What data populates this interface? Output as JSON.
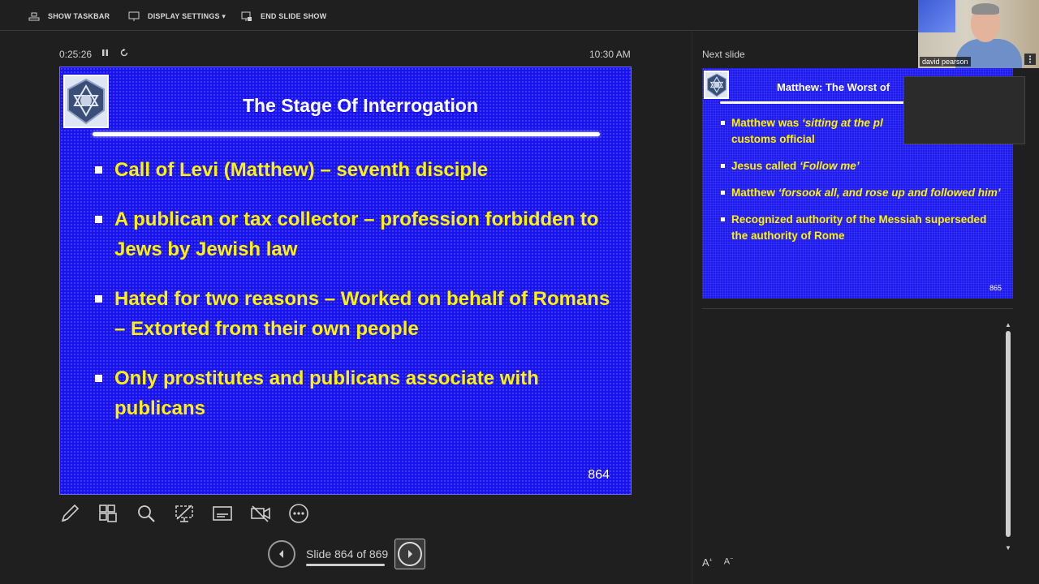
{
  "toolbar": {
    "show_taskbar": "SHOW TASKBAR",
    "display_settings": "DISPLAY SETTINGS ▾",
    "end_slide_show": "END SLIDE SHOW"
  },
  "presenter": {
    "elapsed": "0:25:26",
    "clock": "10:30 AM"
  },
  "current_slide": {
    "title": "The Stage Of Interrogation",
    "bullets": [
      "Call of Levi (Matthew) – seventh disciple",
      "A publican or tax collector – profession forbidden to Jews by Jewish law",
      "Hated for two reasons – Worked on behalf of Romans – Extorted from their own people",
      "Only prostitutes and publicans associate with publicans"
    ],
    "number": "864"
  },
  "navigation": {
    "counter": "Slide 864 of 869"
  },
  "next_panel": {
    "label": "Next slide",
    "title": "Matthew: The Worst of",
    "b1_pre": "Matthew was ",
    "b1_em": "‘sitting at the pl",
    "b1_post": "customs official",
    "b2_pre": "Jesus called ",
    "b2_em": "‘Follow me’",
    "b3_pre": "Matthew ",
    "b3_em": "‘forsook all, and rose up and followed him’",
    "b4": "Recognized authority of the Messiah superseded the authority of Rome",
    "number": "865"
  },
  "webcam": {
    "name": "david pearson"
  },
  "font_controls": {
    "increase": "A",
    "decrease": "A"
  },
  "colors": {
    "slide_bg": "#1a12ee",
    "bullet_text": "#fff200",
    "app_bg": "#1f1f1f"
  }
}
